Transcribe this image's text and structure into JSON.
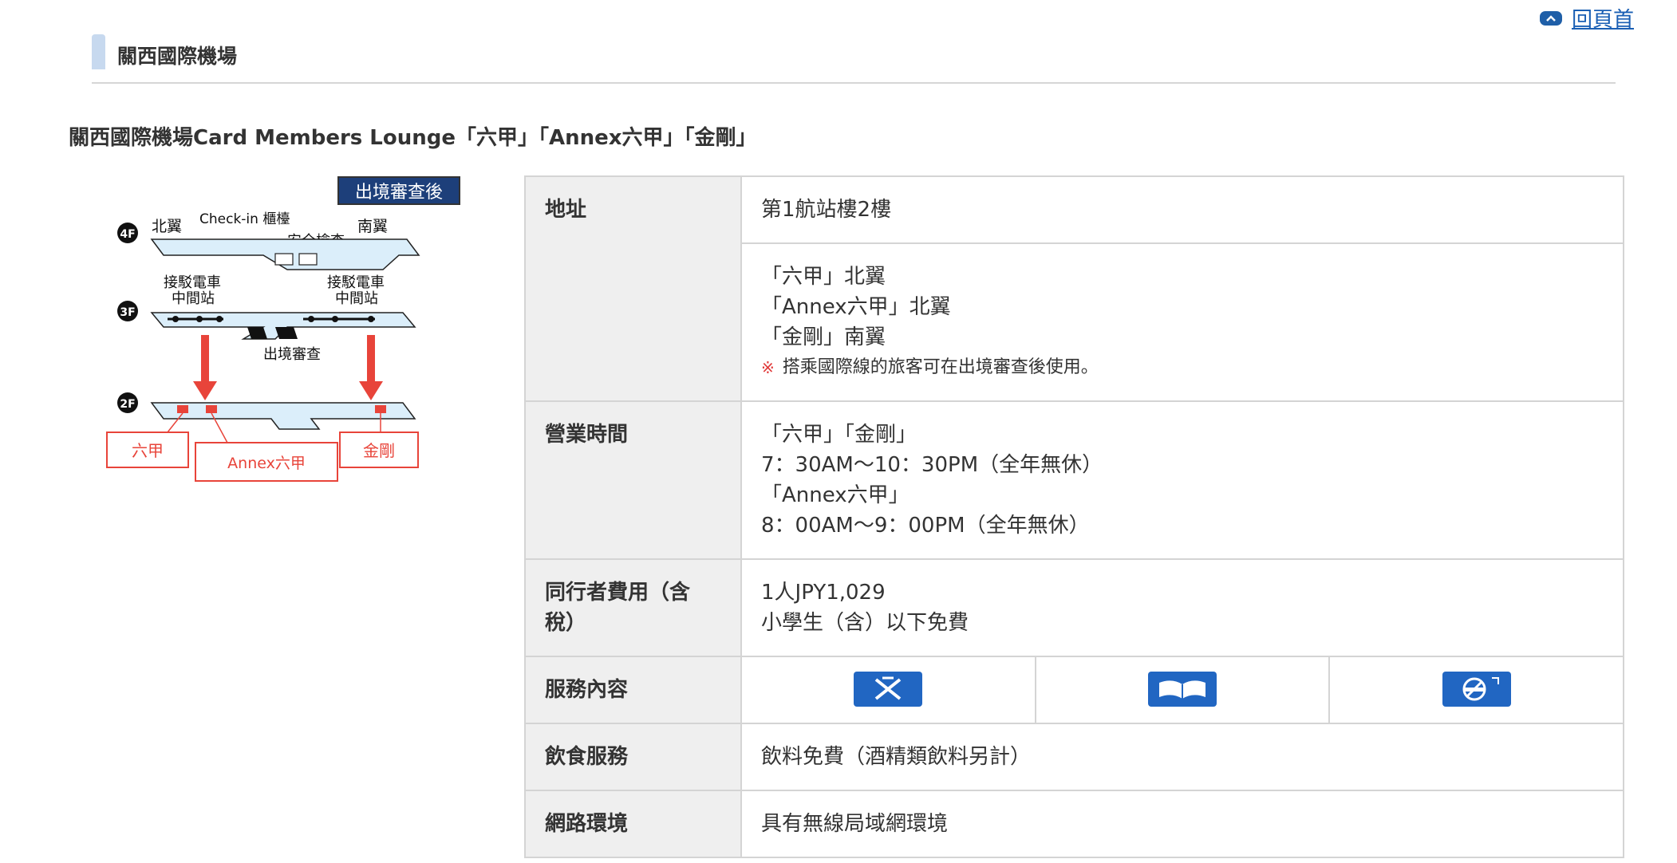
{
  "nav": {
    "back_to_top": "回頁首"
  },
  "section": {
    "title": "關西國際機場"
  },
  "lounge": {
    "title": "關西國際機場Card Members Lounge「六甲」「Annex六甲」「金剛」"
  },
  "map": {
    "badge": "出境審查後",
    "floor_4f": "4F",
    "floor_3f": "3F",
    "floor_2f": "2F",
    "north_wing": "北翼",
    "south_wing": "南翼",
    "checkin": "Check-in 櫃檯",
    "security": "安全檢查",
    "train_left_1": "接駁電車",
    "train_left_2": "中間站",
    "train_right_1": "接駁電車",
    "train_right_2": "中間站",
    "immigration": "出境審查",
    "label_rokko": "六甲",
    "label_annex": "Annex六甲",
    "label_kongo": "金剛"
  },
  "table": {
    "address_label": "地址",
    "address_value": "第1航站樓2樓",
    "location_lines": [
      "「六甲」北翼",
      "「Annex六甲」北翼",
      "「金剛」南翼"
    ],
    "note_mark": "※",
    "note_text": "搭乘國際線的旅客可在出境審查後使用。",
    "hours_label": "營業時間",
    "hours_lines": [
      "「六甲」「金剛」",
      "7：30AM～10：30PM（全年無休）",
      "「Annex六甲」",
      "8：00AM～9：00PM（全年無休）"
    ],
    "fee_label": "同行者費用（含稅）",
    "fee_lines": [
      "1人JPY1,029",
      "小學生（含）以下免費"
    ],
    "service_label": "服務內容",
    "service_icons": [
      "flight-info-icon",
      "reading-icon",
      "no-smoking-icon"
    ],
    "food_label": "飲食服務",
    "food_value": "飲料免費（酒精類飲料另計）",
    "net_label": "網路環境",
    "net_value": "具有無線局域網環境"
  },
  "colors": {
    "accent_blue": "#2166c2",
    "link_blue": "#1a5fb4",
    "map_red": "#e8443a",
    "floor_fill": "#dbeefa"
  }
}
